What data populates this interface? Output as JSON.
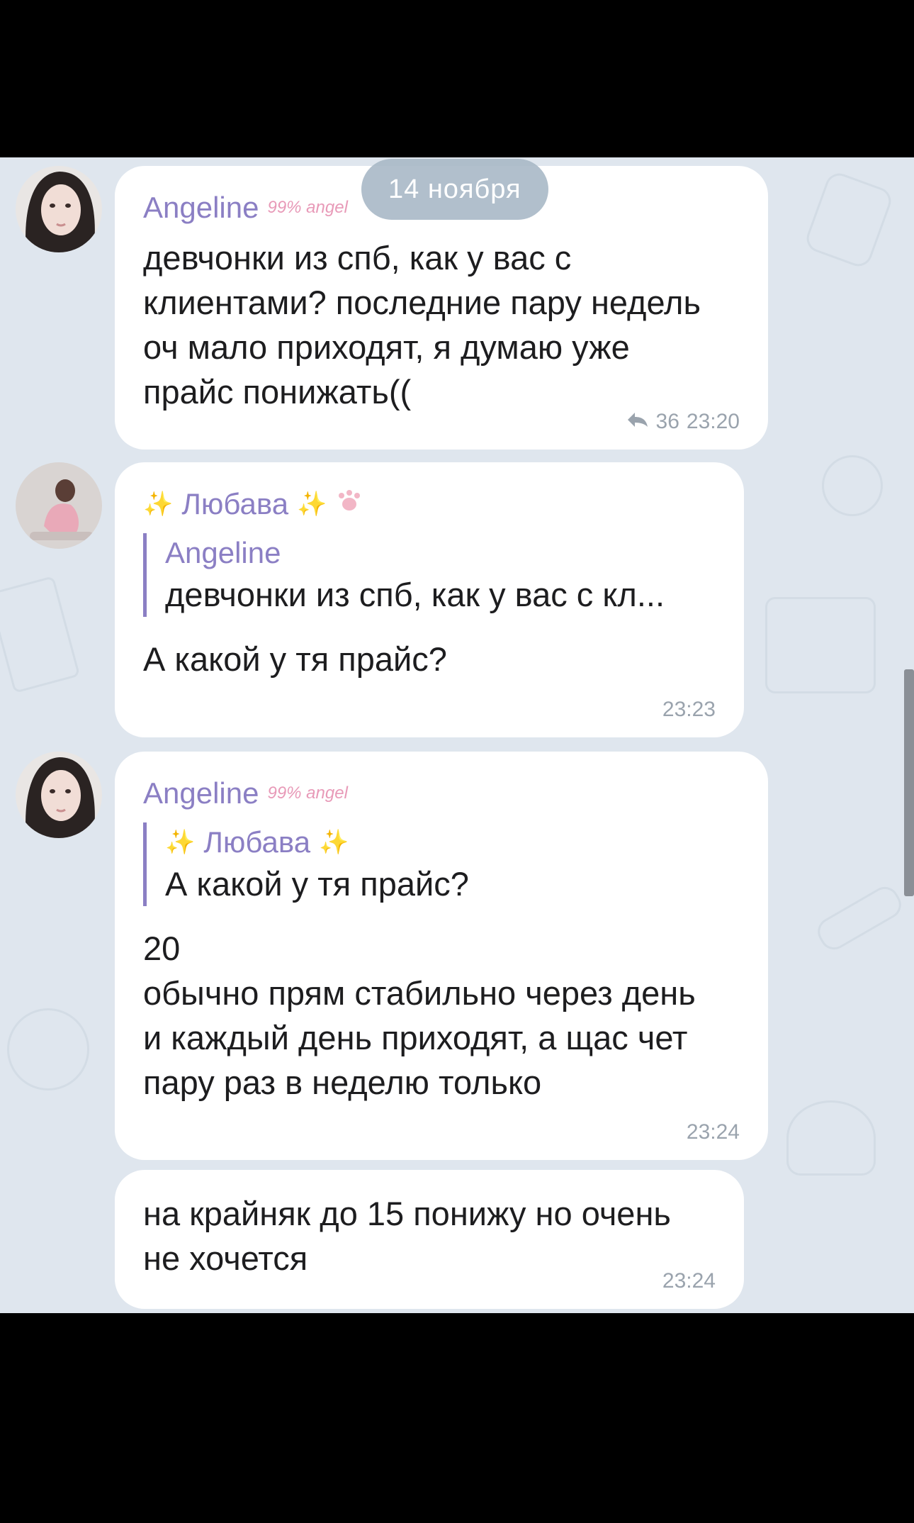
{
  "chat": {
    "date": "14 ноября",
    "messages": [
      {
        "sender": "Angeline",
        "sender_badge": "99% angel",
        "text": "девчонки из спб, как у вас с\nклиентами? последние пару недель\nоч мало приходят, я думаю уже\nпрайс понижать((",
        "replies_count": "36",
        "time": "23:20"
      },
      {
        "sender": "Любава",
        "quote_sender": "Angeline",
        "quote_text": "девчонки из спб, как у вас с кл...",
        "text": "А какой у тя прайс?",
        "time": "23:23"
      },
      {
        "sender": "Angeline",
        "sender_badge": "99% angel",
        "quote_sender": "Любава",
        "quote_text": "А какой у тя прайс?",
        "text": "20\nобычно прям стабильно через день\nи каждый день приходят, а щас чет\nпару раз в неделю только",
        "time": "23:24"
      },
      {
        "text": "на крайняк до 15 понижу но очень\nне хочется",
        "time": "23:24"
      }
    ]
  },
  "colors": {
    "background": "#dfe6ee",
    "bubble": "#ffffff",
    "name": "#8b7fc4",
    "time": "#9aa3ad",
    "sparkle": "#e4c22e"
  },
  "icons": [
    "reply-arrow-icon",
    "sparkle-icon",
    "cat-paw-icon"
  ]
}
